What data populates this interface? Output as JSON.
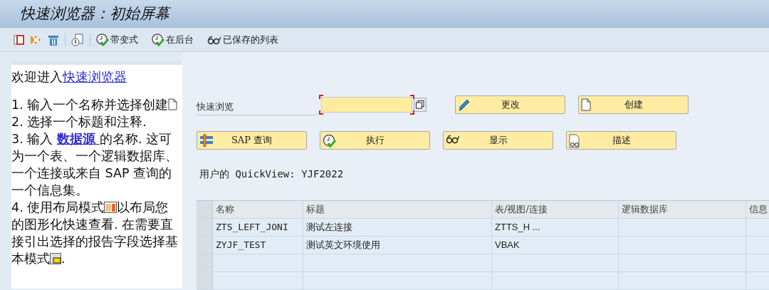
{
  "window": {
    "title": "快速浏览器：初始屏幕"
  },
  "toolbar": [
    {
      "label": "带变式"
    },
    {
      "label": "在后台"
    },
    {
      "label": "已保存的列表"
    }
  ],
  "help": {
    "intro": "欢迎进入",
    "intro_link": "快速浏览器",
    "steps": [
      [
        {
          "kind": "text",
          "text": "1. 输入一个名称并选择创建"
        },
        {
          "kind": "icon"
        }
      ],
      [
        {
          "kind": "text",
          "text": "2. 选择一个标题和注释."
        }
      ],
      [
        {
          "kind": "text",
          "text": "3. 输入 "
        },
        {
          "kind": "link",
          "text": "数据源 "
        },
        {
          "kind": "text",
          "text": "的名称. 这可为一个表、一个逻辑数据库、一个连接或来自 SAP 查询的一个信息集。"
        }
      ],
      [
        {
          "kind": "text",
          "text": "4. 使用布局模式"
        },
        {
          "kind": "icon"
        },
        {
          "kind": "text",
          "text": "以布局您的图形化快速查看. 在需要直接引出选择的报告字段选择基本模式"
        },
        {
          "kind": "icon"
        },
        {
          "kind": "text",
          "text": "."
        }
      ]
    ]
  },
  "quickview_field": {
    "label": "快速浏览"
  },
  "buttons": [
    {
      "label": "更改"
    },
    {
      "label": "创建"
    },
    {
      "label": "SAP 查询"
    },
    {
      "label": "执行"
    },
    {
      "label": "显示"
    },
    {
      "label": "描述"
    }
  ],
  "user_line": "用户的 QuickView: YJF2022",
  "table": {
    "columns": [
      "名称",
      "标题",
      "表/视图/连接",
      "逻辑数据库",
      "信息"
    ],
    "rows": [
      [
        "ZTS_LEFT_JONI",
        "测试左连接",
        "ZTTS_H ...",
        "",
        ""
      ],
      [
        "ZYJF_TEST",
        "测试英文环境使用",
        "VBAK",
        "",
        ""
      ]
    ]
  }
}
